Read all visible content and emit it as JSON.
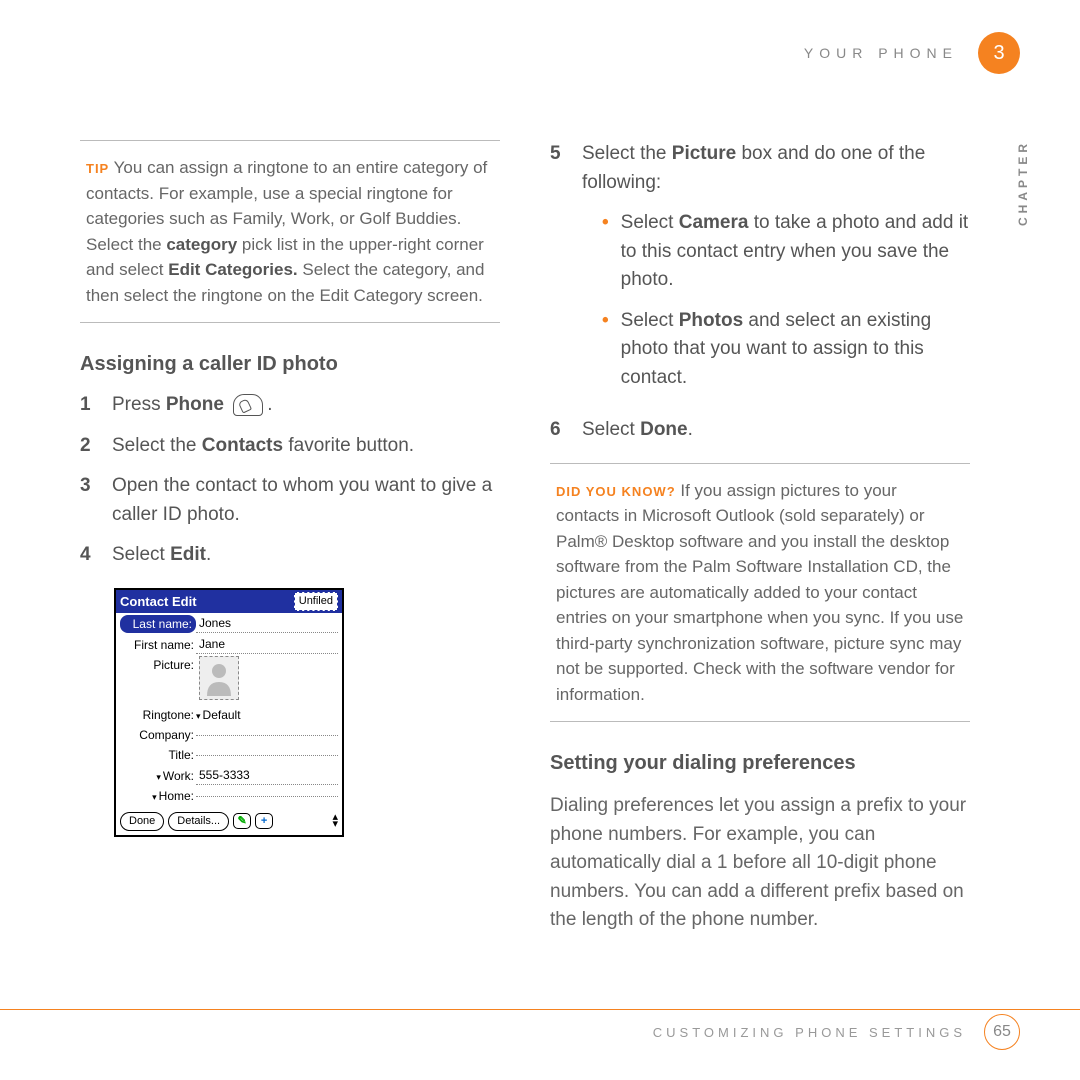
{
  "header": {
    "section": "YOUR PHONE",
    "chapter_num": "3",
    "chapter_label": "CHAPTER"
  },
  "tip": {
    "label": "TIP",
    "body_1": "You can assign a ringtone to an entire category of contacts. For example, use a special ringtone for categories such as Family, Work, or Golf Buddies. Select the ",
    "bold_1": "category",
    "body_2": " pick list in the upper-right corner and select ",
    "bold_2": "Edit Categories.",
    "body_3": " Select the category, and then select the ringtone on the Edit Category screen."
  },
  "sect1": {
    "title": "Assigning a caller ID photo"
  },
  "steps_a": {
    "s1": {
      "n": "1",
      "a": "Press ",
      "b": "Phone",
      "c": "."
    },
    "s2": {
      "n": "2",
      "a": "Select the ",
      "b": "Contacts",
      "c": " favorite button."
    },
    "s3": {
      "n": "3",
      "a": "Open the contact to whom you want to give a caller ID photo."
    },
    "s4": {
      "n": "4",
      "a": "Select ",
      "b": "Edit",
      "c": "."
    }
  },
  "shot": {
    "title": "Contact Edit",
    "category": "Unfiled",
    "rows": {
      "lastname_l": "Last name:",
      "lastname_v": "Jones",
      "firstname_l": "First name:",
      "firstname_v": "Jane",
      "picture_l": "Picture:",
      "ringtone_l": "Ringtone:",
      "ringtone_v": "Default",
      "company_l": "Company:",
      "company_v": "",
      "title_l": "Title:",
      "title_v": "",
      "work_l": "Work:",
      "work_v": "555-3333",
      "home_l": "Home:",
      "home_v": ""
    },
    "btns": {
      "done": "Done",
      "details": "Details...",
      "note": "✎",
      "plus": "+"
    }
  },
  "steps_b": {
    "s5": {
      "n": "5",
      "a": "Select the ",
      "b": "Picture",
      "c": " box and do one of the following:"
    },
    "b1": {
      "a": "Select ",
      "b": "Camera",
      "c": " to take a photo and add it to this contact entry when you save the photo."
    },
    "b2": {
      "a": "Select ",
      "b": "Photos",
      "c": " and select an existing photo that you want to assign to this contact."
    },
    "s6": {
      "n": "6",
      "a": "Select ",
      "b": "Done",
      "c": "."
    }
  },
  "dyk": {
    "label": "DID YOU KNOW?",
    "body": "If you assign pictures to your contacts in Microsoft Outlook (sold separately) or Palm® Desktop software and you install the desktop software from the Palm Software Installation CD, the pictures are automatically added to your contact entries on your smartphone when you sync. If you use third-party synchronization software, picture sync may not be supported. Check with the software vendor for information."
  },
  "sect2": {
    "title": "Setting your dialing preferences",
    "body": "Dialing preferences let you assign a prefix to your phone numbers. For example, you can automatically dial a 1 before all 10-digit phone numbers. You can add a different prefix based on the length of the phone number."
  },
  "footer": {
    "label": "CUSTOMIZING PHONE SETTINGS",
    "page": "65"
  }
}
